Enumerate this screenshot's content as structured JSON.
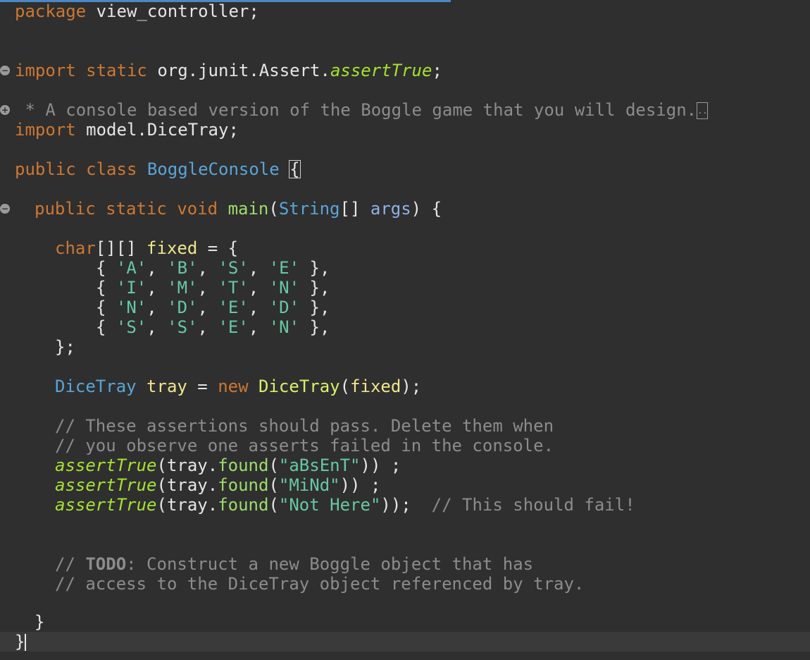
{
  "editor": {
    "line_package": {
      "keyword": "package",
      "name": "view_controller",
      "semicolon": ";"
    },
    "line_import_static": {
      "k1": "import",
      "k2": "static",
      "path": "org.junit.Assert.",
      "method": "assertTrue",
      "semi": ";"
    },
    "line_doc": {
      "text": " * A console based version of the Boggle game that you will design.",
      "collapsed_marker": ".."
    },
    "line_import_model": {
      "k1": "import",
      "path": "model.DiceTray;"
    },
    "line_class": {
      "k1": "public",
      "k2": "class",
      "name": "BoggleConsole",
      "brace": "{"
    },
    "line_main": {
      "k1": "public",
      "k2": "static",
      "k3": "void",
      "name": "main",
      "open": "(",
      "type": "String",
      "arr": "[] ",
      "param": "args",
      "close": ") {"
    },
    "line_char": {
      "type": "char",
      "arr": "[][] ",
      "var": "fixed",
      "rest": " = {"
    },
    "rows": [
      {
        "a": "'A'",
        "b": "'B'",
        "c": "'S'",
        "d": "'E'"
      },
      {
        "a": "'I'",
        "b": "'M'",
        "c": "'T'",
        "d": "'N'"
      },
      {
        "a": "'N'",
        "b": "'D'",
        "c": "'E'",
        "d": "'D'"
      },
      {
        "a": "'S'",
        "b": "'S'",
        "c": "'E'",
        "d": "'N'"
      }
    ],
    "row_open": "{ ",
    "row_sep": ", ",
    "row_close": " },",
    "line_array_end": "};",
    "line_tray": {
      "type": "DiceTray",
      "var": "tray",
      "eq": " = ",
      "kw": "new",
      "ctor": "DiceTray",
      "open": "(",
      "arg": "fixed",
      "close": ");"
    },
    "comment1": "// These assertions should pass. Delete them when",
    "comment2": "// you observe one asserts failed in the console.",
    "asserts": [
      {
        "fn": "assertTrue",
        "pre": "(tray.",
        "method": "found",
        "open": "(",
        "str": "\"aBsEnT\"",
        "close": ")) ;",
        "comment": ""
      },
      {
        "fn": "assertTrue",
        "pre": "(tray.",
        "method": "found",
        "open": "(",
        "str": "\"MiNd\"",
        "close": ")) ;",
        "comment": ""
      },
      {
        "fn": "assertTrue",
        "pre": "(tray.",
        "method": "found",
        "open": "(",
        "str": "\"Not Here\"",
        "close": "));  ",
        "comment": "// This should fail!"
      }
    ],
    "todo": {
      "prefix": "// ",
      "tag": "TODO",
      "rest": ": Construct a new Boggle object that has"
    },
    "comment_todo2": "// access to the DiceTray object referenced by tray.",
    "close_method": "}",
    "close_class": "}"
  }
}
